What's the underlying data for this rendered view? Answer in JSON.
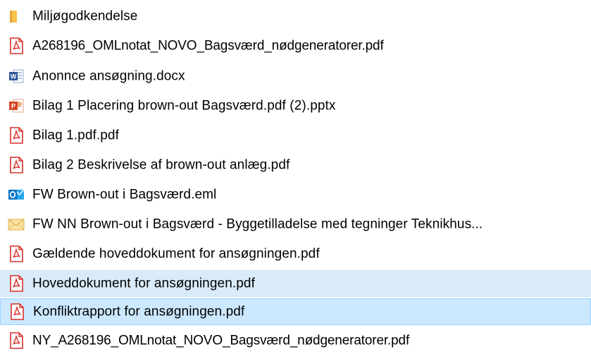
{
  "files": [
    {
      "name": "Miljøgodkendelse",
      "type": "folder",
      "icon": "folder-icon",
      "selected": false
    },
    {
      "name": "A268196_OMLnotat_NOVO_Bagsværd_nødgeneratorer.pdf",
      "type": "pdf",
      "icon": "pdf-icon",
      "selected": false
    },
    {
      "name": "Anonnce ansøgning.docx",
      "type": "docx",
      "icon": "word-icon",
      "selected": false
    },
    {
      "name": "Bilag 1 Placering brown-out  Bagsværd.pdf (2).pptx",
      "type": "pptx",
      "icon": "powerpoint-icon",
      "selected": false
    },
    {
      "name": "Bilag 1.pdf.pdf",
      "type": "pdf",
      "icon": "pdf-icon",
      "selected": false
    },
    {
      "name": "Bilag 2 Beskrivelse af brown-out anlæg.pdf",
      "type": "pdf",
      "icon": "pdf-icon",
      "selected": false
    },
    {
      "name": "FW Brown-out i Bagsværd.eml",
      "type": "eml",
      "icon": "outlook-icon",
      "selected": false
    },
    {
      "name": "FW NN Brown-out i Bagsværd - Byggetilladelse med tegninger Teknikhus...",
      "type": "msg",
      "icon": "envelope-icon",
      "selected": false
    },
    {
      "name": "Gældende hoveddokument for ansøgningen.pdf",
      "type": "pdf",
      "icon": "pdf-icon",
      "selected": false
    },
    {
      "name": "Hoveddokument for ansøgningen.pdf",
      "type": "pdf",
      "icon": "pdf-icon",
      "selected": true
    },
    {
      "name": "Konfliktrapport for ansøgningen.pdf",
      "type": "pdf",
      "icon": "pdf-icon",
      "selected": true
    },
    {
      "name": "NY_A268196_OMLnotat_NOVO_Bagsværd_nødgeneratorer.pdf",
      "type": "pdf",
      "icon": "pdf-icon",
      "selected": false
    }
  ],
  "colors": {
    "selection_bg": "#cce8ff",
    "selection_border": "#99d1ff",
    "folder": "#f8c34a",
    "pdf": "#d9302c",
    "word": "#2b579a",
    "powerpoint": "#d24726",
    "outlook": "#0072c6",
    "envelope": "#f2c867"
  }
}
